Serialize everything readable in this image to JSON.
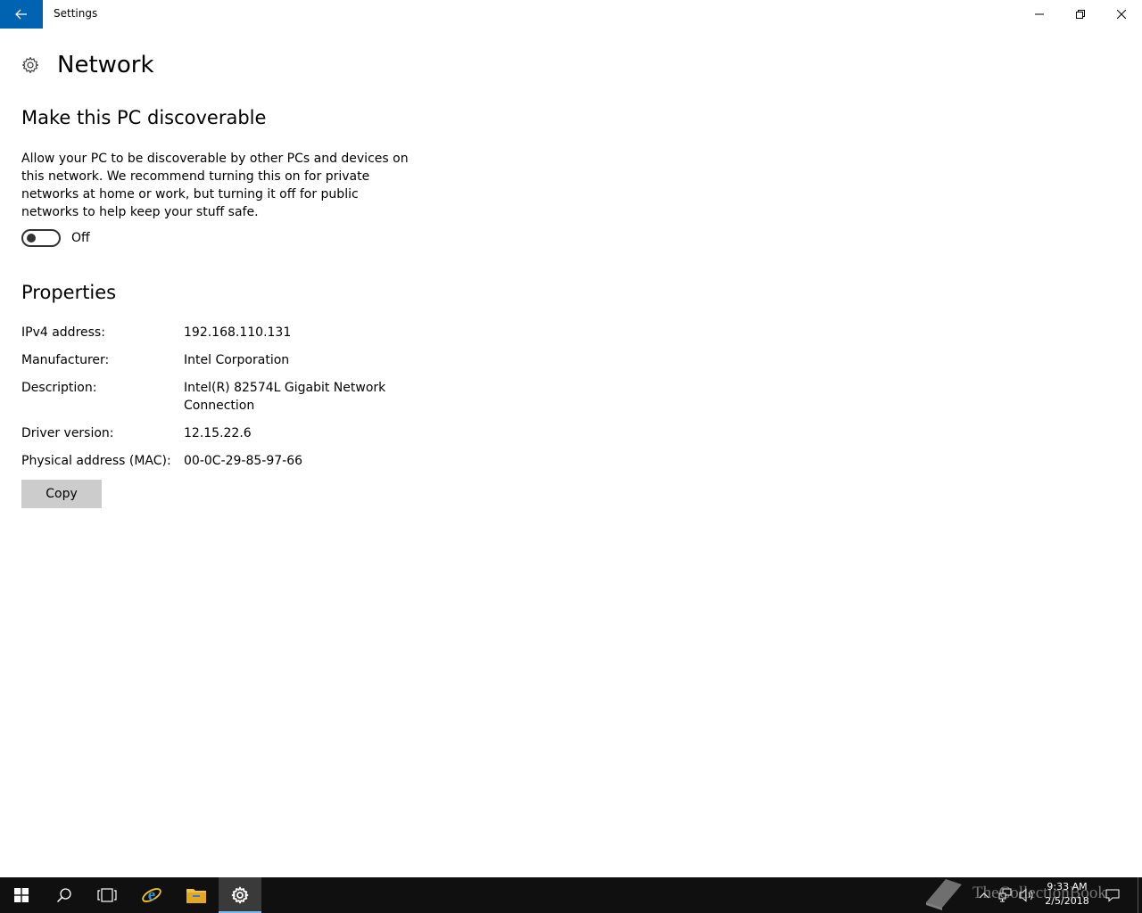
{
  "window": {
    "title": "Settings"
  },
  "page": {
    "title": "Network"
  },
  "discoverable": {
    "heading": "Make this PC discoverable",
    "description": "Allow your PC to be discoverable by other PCs and devices on this network. We recommend turning this on for private networks at home or work, but turning it off for public networks to help keep your stuff safe.",
    "toggle_state": "Off",
    "toggle_on": false
  },
  "properties": {
    "heading": "Properties",
    "rows": [
      {
        "label": "IPv4 address:",
        "value": "192.168.110.131"
      },
      {
        "label": "Manufacturer:",
        "value": "Intel Corporation"
      },
      {
        "label": "Description:",
        "value": "Intel(R) 82574L Gigabit Network Connection"
      },
      {
        "label": "Driver version:",
        "value": "12.15.22.6"
      },
      {
        "label": "Physical address (MAC):",
        "value": "00-0C-29-85-97-66"
      }
    ],
    "copy_label": "Copy"
  },
  "taskbar": {
    "items": [
      {
        "icon": "windows-start-icon"
      },
      {
        "icon": "search-icon"
      },
      {
        "icon": "task-view-icon"
      },
      {
        "icon": "internet-explorer-icon"
      },
      {
        "icon": "file-explorer-icon"
      },
      {
        "icon": "settings-gear-icon",
        "active": true
      }
    ],
    "clock_time": "9:33 AM",
    "clock_date": "2/5/2018",
    "watermark": "TheCollectionBook"
  },
  "colors": {
    "accent": "#0063b1",
    "taskbar": "#101010",
    "button": "#cccccc"
  }
}
